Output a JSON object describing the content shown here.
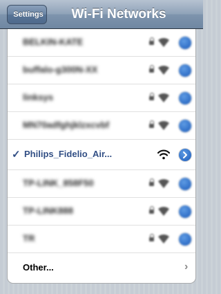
{
  "navbar": {
    "back_label": "Settings",
    "title": "Wi-Fi Networks"
  },
  "networks": [
    {
      "name": "BELKIN-KATE",
      "blurred": true,
      "locked": true,
      "selected": false
    },
    {
      "name": "buffalo-g300N-XX",
      "blurred": true,
      "locked": true,
      "selected": false
    },
    {
      "name": "linksys",
      "blurred": true,
      "locked": true,
      "selected": false
    },
    {
      "name": "MN70adfghjklzxcvbf",
      "blurred": true,
      "locked": true,
      "selected": false
    },
    {
      "name": "Philips_Fidelio_Air...",
      "blurred": false,
      "locked": false,
      "selected": true
    },
    {
      "name": "TP-LINK_858F50",
      "blurred": true,
      "locked": true,
      "selected": false
    },
    {
      "name": "TP-LINK888",
      "blurred": true,
      "locked": true,
      "selected": false
    },
    {
      "name": "TR",
      "blurred": true,
      "locked": true,
      "selected": false
    }
  ],
  "other": {
    "label": "Other..."
  },
  "icons": {
    "checkmark": "✓",
    "chevron": "›"
  },
  "colors": {
    "accent": "#324f85",
    "detail_button": "#2f6ec7"
  }
}
